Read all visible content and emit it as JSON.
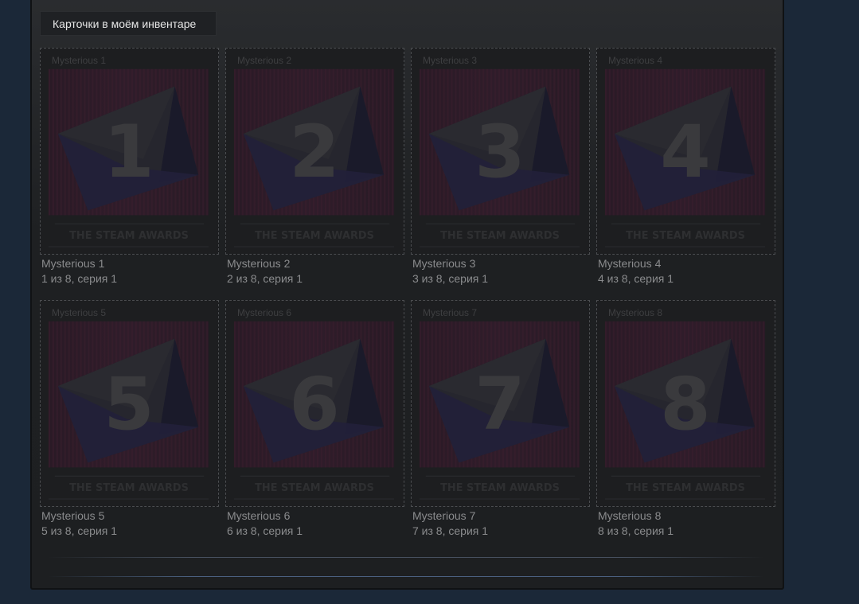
{
  "tab": {
    "label": "Карточки в моём инвентаре"
  },
  "cards": [
    {
      "overlay": "Mysterious 1",
      "number": "1",
      "name": "Mysterious 1",
      "series": "1 из 8, серия 1"
    },
    {
      "overlay": "Mysterious 2",
      "number": "2",
      "name": "Mysterious 2",
      "series": "2 из 8, серия 1"
    },
    {
      "overlay": "Mysterious 3",
      "number": "3",
      "name": "Mysterious 3",
      "series": "3 из 8, серия 1"
    },
    {
      "overlay": "Mysterious 4",
      "number": "4",
      "name": "Mysterious 4",
      "series": "4 из 8, серия 1"
    },
    {
      "overlay": "Mysterious 5",
      "number": "5",
      "name": "Mysterious 5",
      "series": "5 из 8, серия 1"
    },
    {
      "overlay": "Mysterious 6",
      "number": "6",
      "name": "Mysterious 6",
      "series": "6 из 8, серия 1"
    },
    {
      "overlay": "Mysterious 7",
      "number": "7",
      "name": "Mysterious 7",
      "series": "7 из 8, серия 1"
    },
    {
      "overlay": "Mysterious 8",
      "number": "8",
      "name": "Mysterious 8",
      "series": "8 из 8, серия 1"
    }
  ],
  "card_footer": "THE STEAM AWARDS",
  "colors": {
    "page_bg": "#1b2838",
    "panel_bg": "#1e2022",
    "caption": "#8a8b8d",
    "card_border": "#4b4d50"
  },
  "icons": {
    "card_art": "envelope-icon"
  }
}
